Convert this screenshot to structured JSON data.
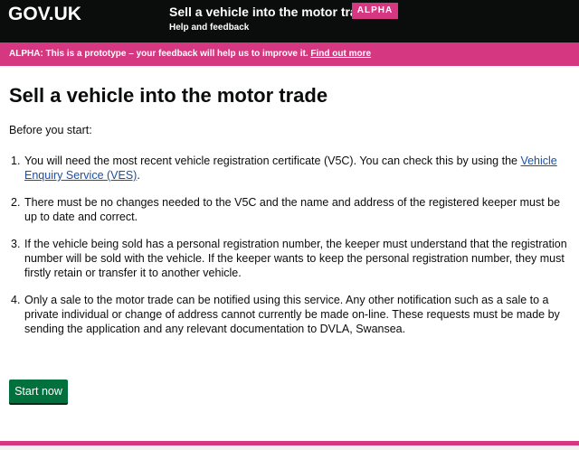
{
  "header": {
    "logo": "GOV.UK",
    "service_name": "Sell a vehicle into the motor trade",
    "phase_tag": "ALPHA",
    "help_link": "Help and feedback"
  },
  "banner": {
    "text": "ALPHA: This is a prototype – your feedback will help us to improve it.",
    "link": "Find out more"
  },
  "main": {
    "title": "Sell a vehicle into the motor trade",
    "lede": "Before you start:",
    "items": [
      {
        "number": "1.",
        "text_before": "You will need the most recent vehicle registration certificate (V5C). You can check this by using the ",
        "link": "Vehicle Enquiry Service (VES)",
        "text_after": "."
      },
      {
        "number": "2.",
        "text": "There must be no changes needed to the V5C and the name and address of the registered keeper must be up to date and correct."
      },
      {
        "number": "3.",
        "text": "If the vehicle being sold has a personal registration number, the keeper must understand that the registration number will be sold with the vehicle. If the keeper wants to keep the personal registration number, they must firstly retain or transfer it to another vehicle."
      },
      {
        "number": "4.",
        "text": "Only a sale to the motor trade can be notified using this service. Any other notification such as a sale to a private individual or change of address cannot currently be made on-line. These requests must be made by sending the application and any relevant documentation to DVLA, Swansea."
      }
    ],
    "start_button": "Start now"
  },
  "colors": {
    "header_bg": "#0b0c0c",
    "accent_pink": "#d53880",
    "button_green": "#00703c",
    "link_blue": "#1d4fa1"
  }
}
